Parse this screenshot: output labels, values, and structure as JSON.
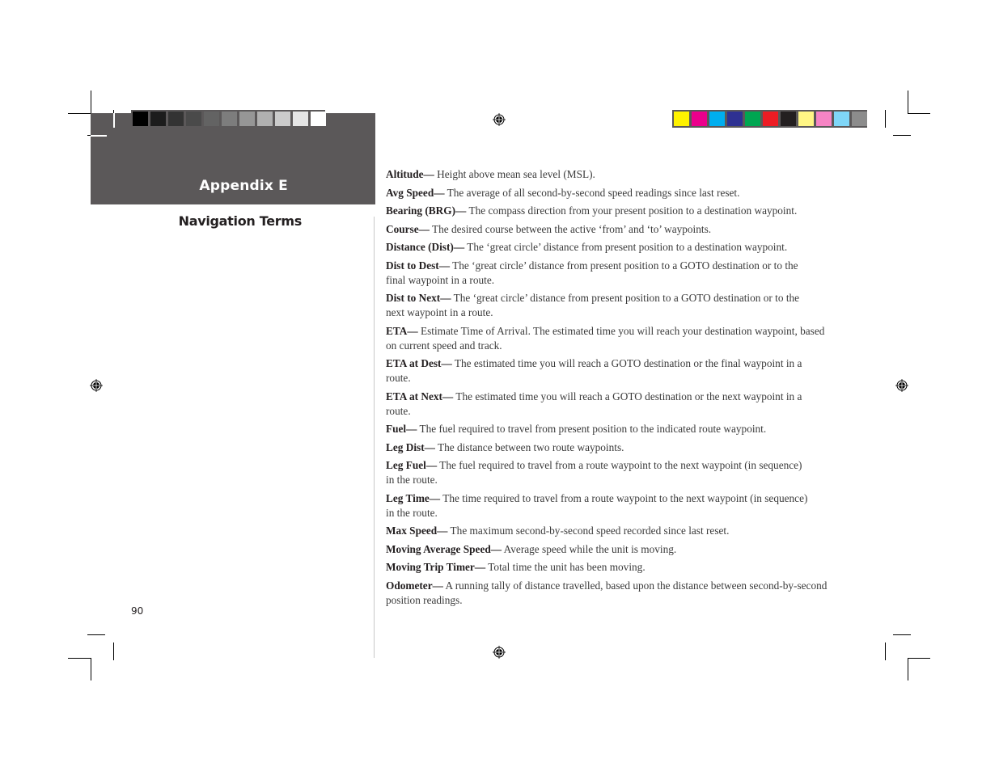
{
  "header": {
    "appendix_title": "Appendix E",
    "section_title": "Navigation Terms"
  },
  "page_number": "90",
  "gray_swatches": [
    "#000000",
    "#1c1c1c",
    "#333333",
    "#4a4a4a",
    "#636363",
    "#7d7d7d",
    "#969696",
    "#b0b0b0",
    "#cbcbcb",
    "#e5e5e5",
    "#ffffff"
  ],
  "color_swatches": [
    "#fff200",
    "#ec008c",
    "#00aeef",
    "#2e3192",
    "#00a651",
    "#ed1c24",
    "#231f20",
    "#fff685",
    "#f684c4",
    "#7fd6f7",
    "#8c8c8c"
  ],
  "terms": [
    {
      "name": "Altitude—",
      "definition": " Height above mean sea level (MSL)."
    },
    {
      "name": "Avg Speed—",
      "definition": " The average of all second-by-second speed readings since last reset."
    },
    {
      "name": "Bearing (BRG)—",
      "definition": " The compass direction from your present position to a destination waypoint."
    },
    {
      "name": "Course—",
      "definition": " The desired course between the active ‘from’ and ‘to’ waypoints."
    },
    {
      "name": "Distance (Dist)—",
      "definition": " The ‘great circle’ distance from present position to a destination waypoint."
    },
    {
      "name": "Dist to Dest—",
      "definition": " The ‘great circle’ distance from present position to a GOTO destination or to the final waypoint in a route."
    },
    {
      "name": "Dist to Next—",
      "definition": " The ‘great circle’ distance from present position to a GOTO destination or to the next waypoint in a route."
    },
    {
      "name": "ETA—",
      "definition": " Estimate Time of Arrival. The estimated time you will reach your destination waypoint, based on current speed and track."
    },
    {
      "name": "ETA at Dest—",
      "definition": " The estimated time you will reach a GOTO destination or the final waypoint in a route."
    },
    {
      "name": "ETA at Next—",
      "definition": " The estimated time you will reach a GOTO destination or the next waypoint in a route."
    },
    {
      "name": "Fuel—",
      "definition": " The fuel required to travel from present position to the indicated route waypoint."
    },
    {
      "name": "Leg Dist—",
      "definition": " The distance between two route waypoints."
    },
    {
      "name": "Leg Fuel—",
      "definition": " The fuel required to travel from a route waypoint to the next waypoint (in sequence) in the route."
    },
    {
      "name": "Leg Time—",
      "definition": " The time required to travel from a route waypoint to the next waypoint (in sequence) in the route."
    },
    {
      "name": "Max Speed—",
      "definition": " The maximum second-by-second speed recorded since last reset."
    },
    {
      "name": "Moving Average Speed—",
      "definition": " Average speed while the unit is moving."
    },
    {
      "name": "Moving Trip Timer—",
      "definition": " Total time the unit has been moving."
    },
    {
      "name": "Odometer—",
      "definition": " A running tally of distance travelled, based upon the distance between second-by-second position readings."
    }
  ]
}
